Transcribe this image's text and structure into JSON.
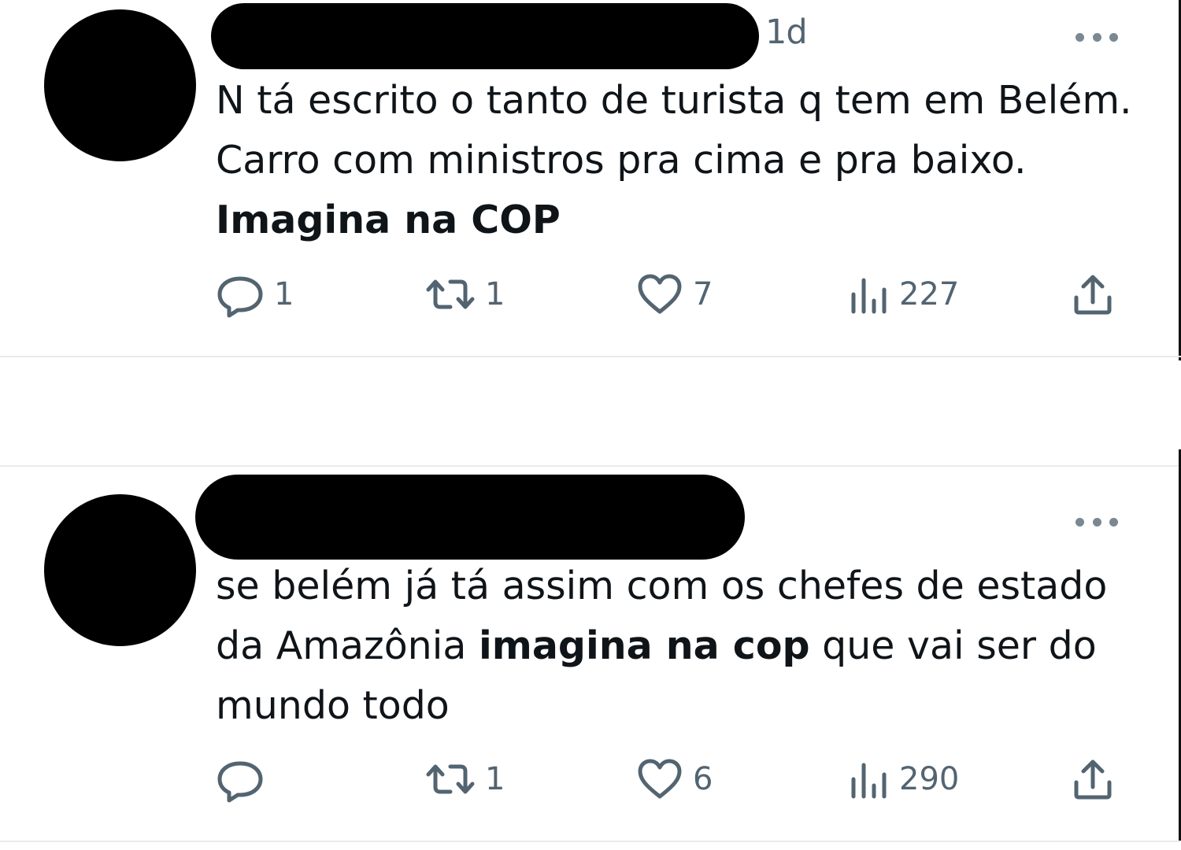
{
  "tweets": [
    {
      "timestamp": "1d",
      "text_parts": [
        {
          "text": "N tá escrito o tanto de turista q tem em Belém. Carro com ministros pra cima e pra baixo. ",
          "bold": false
        },
        {
          "text": "Imagina na COP",
          "bold": true
        }
      ],
      "replies": "1",
      "retweets": "1",
      "likes": "7",
      "views": "227"
    },
    {
      "timestamp": "",
      "text_parts": [
        {
          "text": "se belém já tá assim com os chefes de estado da Amazônia ",
          "bold": false
        },
        {
          "text": "imagina na cop",
          "bold": true
        },
        {
          "text": " que vai ser do mundo todo",
          "bold": false
        }
      ],
      "replies": "",
      "retweets": "1",
      "likes": "6",
      "views": "290"
    }
  ],
  "icons": {
    "reply": "reply-icon",
    "retweet": "retweet-icon",
    "like": "heart-icon",
    "views": "views-icon",
    "share": "share-icon",
    "more": "more-icon"
  },
  "colors": {
    "text": "#0f1419",
    "muted": "#536471",
    "divider": "#e8ebed"
  }
}
